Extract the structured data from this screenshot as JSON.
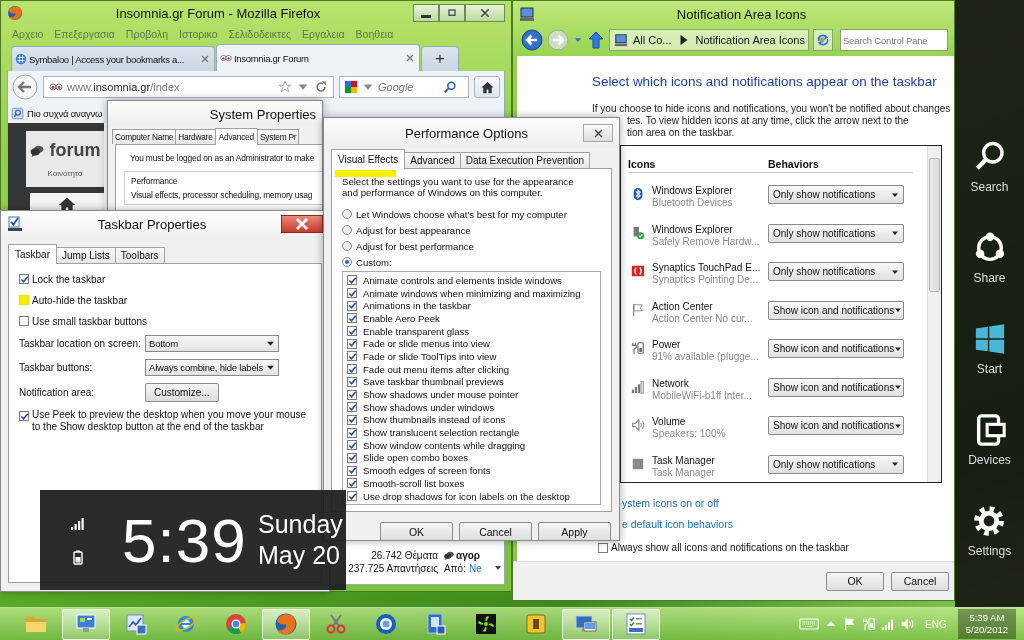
{
  "firefox": {
    "title": "Insomnia.gr Forum - Mozilla Firefox",
    "menu": [
      "Αρχειο",
      "Επεξεργασια",
      "Προβολη",
      "Ιστορικο",
      "Σελιδοδεικτες",
      "Εργαλεια",
      "Βοηθεια"
    ],
    "tabs": [
      {
        "label": "Symbaloo | Access your bookmarks a...",
        "selected": false
      },
      {
        "label": "Insomnia.gr Forum",
        "selected": true
      }
    ],
    "new_tab": "+",
    "address": "www.**insomnia.gr**/index",
    "search": {
      "placeholder": "Google"
    },
    "bookmark": "Πιο συχνά αναγνω",
    "page": {
      "section": "forum",
      "section_subtitle": "Κοινότητα",
      "stats": [
        "26.742 Θέματα",
        "237.725 Απαντήσεις"
      ],
      "latest_title": "αγορ",
      "latest_from_label": "Από:",
      "latest_from": "Ne"
    }
  },
  "system_properties": {
    "title": "System Properties",
    "tabs": [
      {
        "label": "Computer Name",
        "selected": false
      },
      {
        "label": "Hardware",
        "selected": false
      },
      {
        "label": "Advanced",
        "selected": true
      },
      {
        "label": "System Pr",
        "selected": false
      }
    ],
    "notice": "You must be logged on as an Administrator to make",
    "group_title": "Performance",
    "group_text": "Visual effects, processor scheduling, memory usag"
  },
  "taskbar_properties": {
    "title": "Taskbar Properties",
    "tabs": [
      {
        "label": "Taskbar",
        "selected": true
      },
      {
        "label": "Jump Lists",
        "selected": false
      },
      {
        "label": "Toolbars",
        "selected": false
      }
    ],
    "options": [
      {
        "kind": "checkbox",
        "label": "Lock the taskbar",
        "checked": true,
        "highlighted": false
      },
      {
        "kind": "checkbox",
        "label": "Auto-hide the taskbar",
        "checked": false,
        "highlighted": true
      },
      {
        "kind": "checkbox",
        "label": "Use small taskbar buttons",
        "checked": false,
        "highlighted": false
      },
      {
        "kind": "select",
        "label": "Taskbar location on screen:",
        "value": "Bottom"
      },
      {
        "kind": "select",
        "label": "Taskbar buttons:",
        "value": "Always combine, hide labels"
      },
      {
        "kind": "button",
        "label": "Notification area:",
        "value": "Customize..."
      },
      {
        "kind": "checkbox",
        "label": "Use Peek to preview the desktop when you move your mouse to the Show desktop button at the end of the taskbar",
        "checked": true,
        "highlighted": false
      }
    ]
  },
  "performance_options": {
    "title": "Performance Options",
    "tabs": [
      {
        "label": "Visual Effects",
        "selected": true,
        "highlighted": true
      },
      {
        "label": "Advanced",
        "selected": false,
        "highlighted": false
      },
      {
        "label": "Data Execution Prevention",
        "selected": false,
        "highlighted": false
      }
    ],
    "intro": "Select the settings you want to use for the appearance and performance of Windows on this computer.",
    "modes": [
      {
        "label": "Let Windows choose what's best for my computer",
        "selected": false
      },
      {
        "label": "Adjust for best appearance",
        "selected": false
      },
      {
        "label": "Adjust for best performance",
        "selected": false
      },
      {
        "label": "Custom:",
        "selected": true
      }
    ],
    "effects": [
      {
        "label": "Animate controls and elements inside windows",
        "checked": true
      },
      {
        "label": "Animate windows when minimizing and maximizing",
        "checked": true
      },
      {
        "label": "Animations in the taskbar",
        "checked": true
      },
      {
        "label": "Enable Aero Peek",
        "checked": true
      },
      {
        "label": "Enable transparent glass",
        "checked": true
      },
      {
        "label": "Fade or slide menus into view",
        "checked": true
      },
      {
        "label": "Fade or slide ToolTips into view",
        "checked": true
      },
      {
        "label": "Fade out menu items after clicking",
        "checked": true
      },
      {
        "label": "Save taskbar thumbnail previews",
        "checked": true
      },
      {
        "label": "Show shadows under mouse pointer",
        "checked": true
      },
      {
        "label": "Show shadows under windows",
        "checked": true
      },
      {
        "label": "Show thumbnails instead of icons",
        "checked": true
      },
      {
        "label": "Show translucent selection rectangle",
        "checked": true
      },
      {
        "label": "Show window contents while dragging",
        "checked": true
      },
      {
        "label": "Slide open combo boxes",
        "checked": true
      },
      {
        "label": "Smooth edges of screen fonts",
        "checked": true
      },
      {
        "label": "Smooth-scroll list boxes",
        "checked": true
      },
      {
        "label": "Use drop shadows for icon labels on the desktop",
        "checked": true
      }
    ],
    "buttons": [
      "OK",
      "Cancel",
      "Apply"
    ]
  },
  "notification_area": {
    "title": "Notification Area Icons",
    "breadcrumb": [
      "All Co...",
      "Notification Area Icons"
    ],
    "search": {
      "placeholder": "Search Control Pane"
    },
    "heading": "Select which icons and notifications appear on the taskbar",
    "description": [
      "If you choose to hide icons and notifications, you won't be notified about changes",
      "tes. To view hidden icons at any time, click the arrow next to the",
      "tion area on the taskbar."
    ],
    "columns": [
      "Icons",
      "Behaviors"
    ],
    "rows": [
      {
        "kind": "bluetooth",
        "name": "Windows Explorer",
        "detail": "Bluetooth Devices",
        "behavior": "Only show notifications"
      },
      {
        "kind": "usb",
        "name": "Windows Explorer",
        "detail": "Safely Remove Hardw...",
        "behavior": "Only show notifications"
      },
      {
        "kind": "touchpad",
        "name": "Synaptics TouchPad E...",
        "detail": "Synaptics Pointing De...",
        "behavior": "Only show notifications"
      },
      {
        "kind": "flag",
        "name": "Action Center",
        "detail": "Action Center  No cur...",
        "behavior": "Show icon and notifications"
      },
      {
        "kind": "power",
        "name": "Power",
        "detail": "91% available (plugge...",
        "behavior": "Show icon and notifications"
      },
      {
        "kind": "network",
        "name": "Network",
        "detail": "MobileWiFi-b1ff Inter...",
        "behavior": "Show icon and notifications"
      },
      {
        "kind": "volume",
        "name": "Volume",
        "detail": "Speakers: 100%",
        "behavior": "Show icon and notifications"
      },
      {
        "kind": "generic",
        "name": "Task Manager",
        "detail": "Task Manager",
        "behavior": "Only show notifications"
      }
    ],
    "links": [
      "ystem icons on or off",
      "e default icon behaviors"
    ],
    "always_show": {
      "label": "Always show all icons and notifications on the taskbar",
      "checked": false
    },
    "buttons": [
      "OK",
      "Cancel"
    ]
  },
  "clock": {
    "time": "5:39",
    "day": "Sunday",
    "date": "May 20"
  },
  "charms": [
    {
      "kind": "search",
      "label": "Search"
    },
    {
      "kind": "share",
      "label": "Share"
    },
    {
      "kind": "start",
      "label": "Start"
    },
    {
      "kind": "devices",
      "label": "Devices"
    },
    {
      "kind": "settings",
      "label": "Settings"
    }
  ],
  "taskbar": {
    "apps": [
      {
        "kind": "folder",
        "open": false
      },
      {
        "kind": "panel",
        "open": true
      },
      {
        "kind": "chart",
        "open": false
      },
      {
        "kind": "globe",
        "open": false
      },
      {
        "kind": "ring",
        "open": false
      },
      {
        "kind": "fox",
        "open": true
      },
      {
        "kind": "scissors",
        "open": false
      },
      {
        "kind": "badge",
        "open": false
      },
      {
        "kind": "frame",
        "open": false
      },
      {
        "kind": "fan",
        "open": false
      },
      {
        "kind": "square",
        "open": false
      },
      {
        "kind": "monitors",
        "open": true
      },
      {
        "kind": "checklist",
        "open": true
      }
    ],
    "tray": [
      {
        "kind": "keyboard"
      },
      {
        "kind": "up"
      },
      {
        "kind": "flag"
      },
      {
        "kind": "power"
      },
      {
        "kind": "signal"
      },
      {
        "kind": "volume"
      }
    ],
    "language": "ENG",
    "time": "5:39 AM",
    "date": "5/20/2012"
  }
}
